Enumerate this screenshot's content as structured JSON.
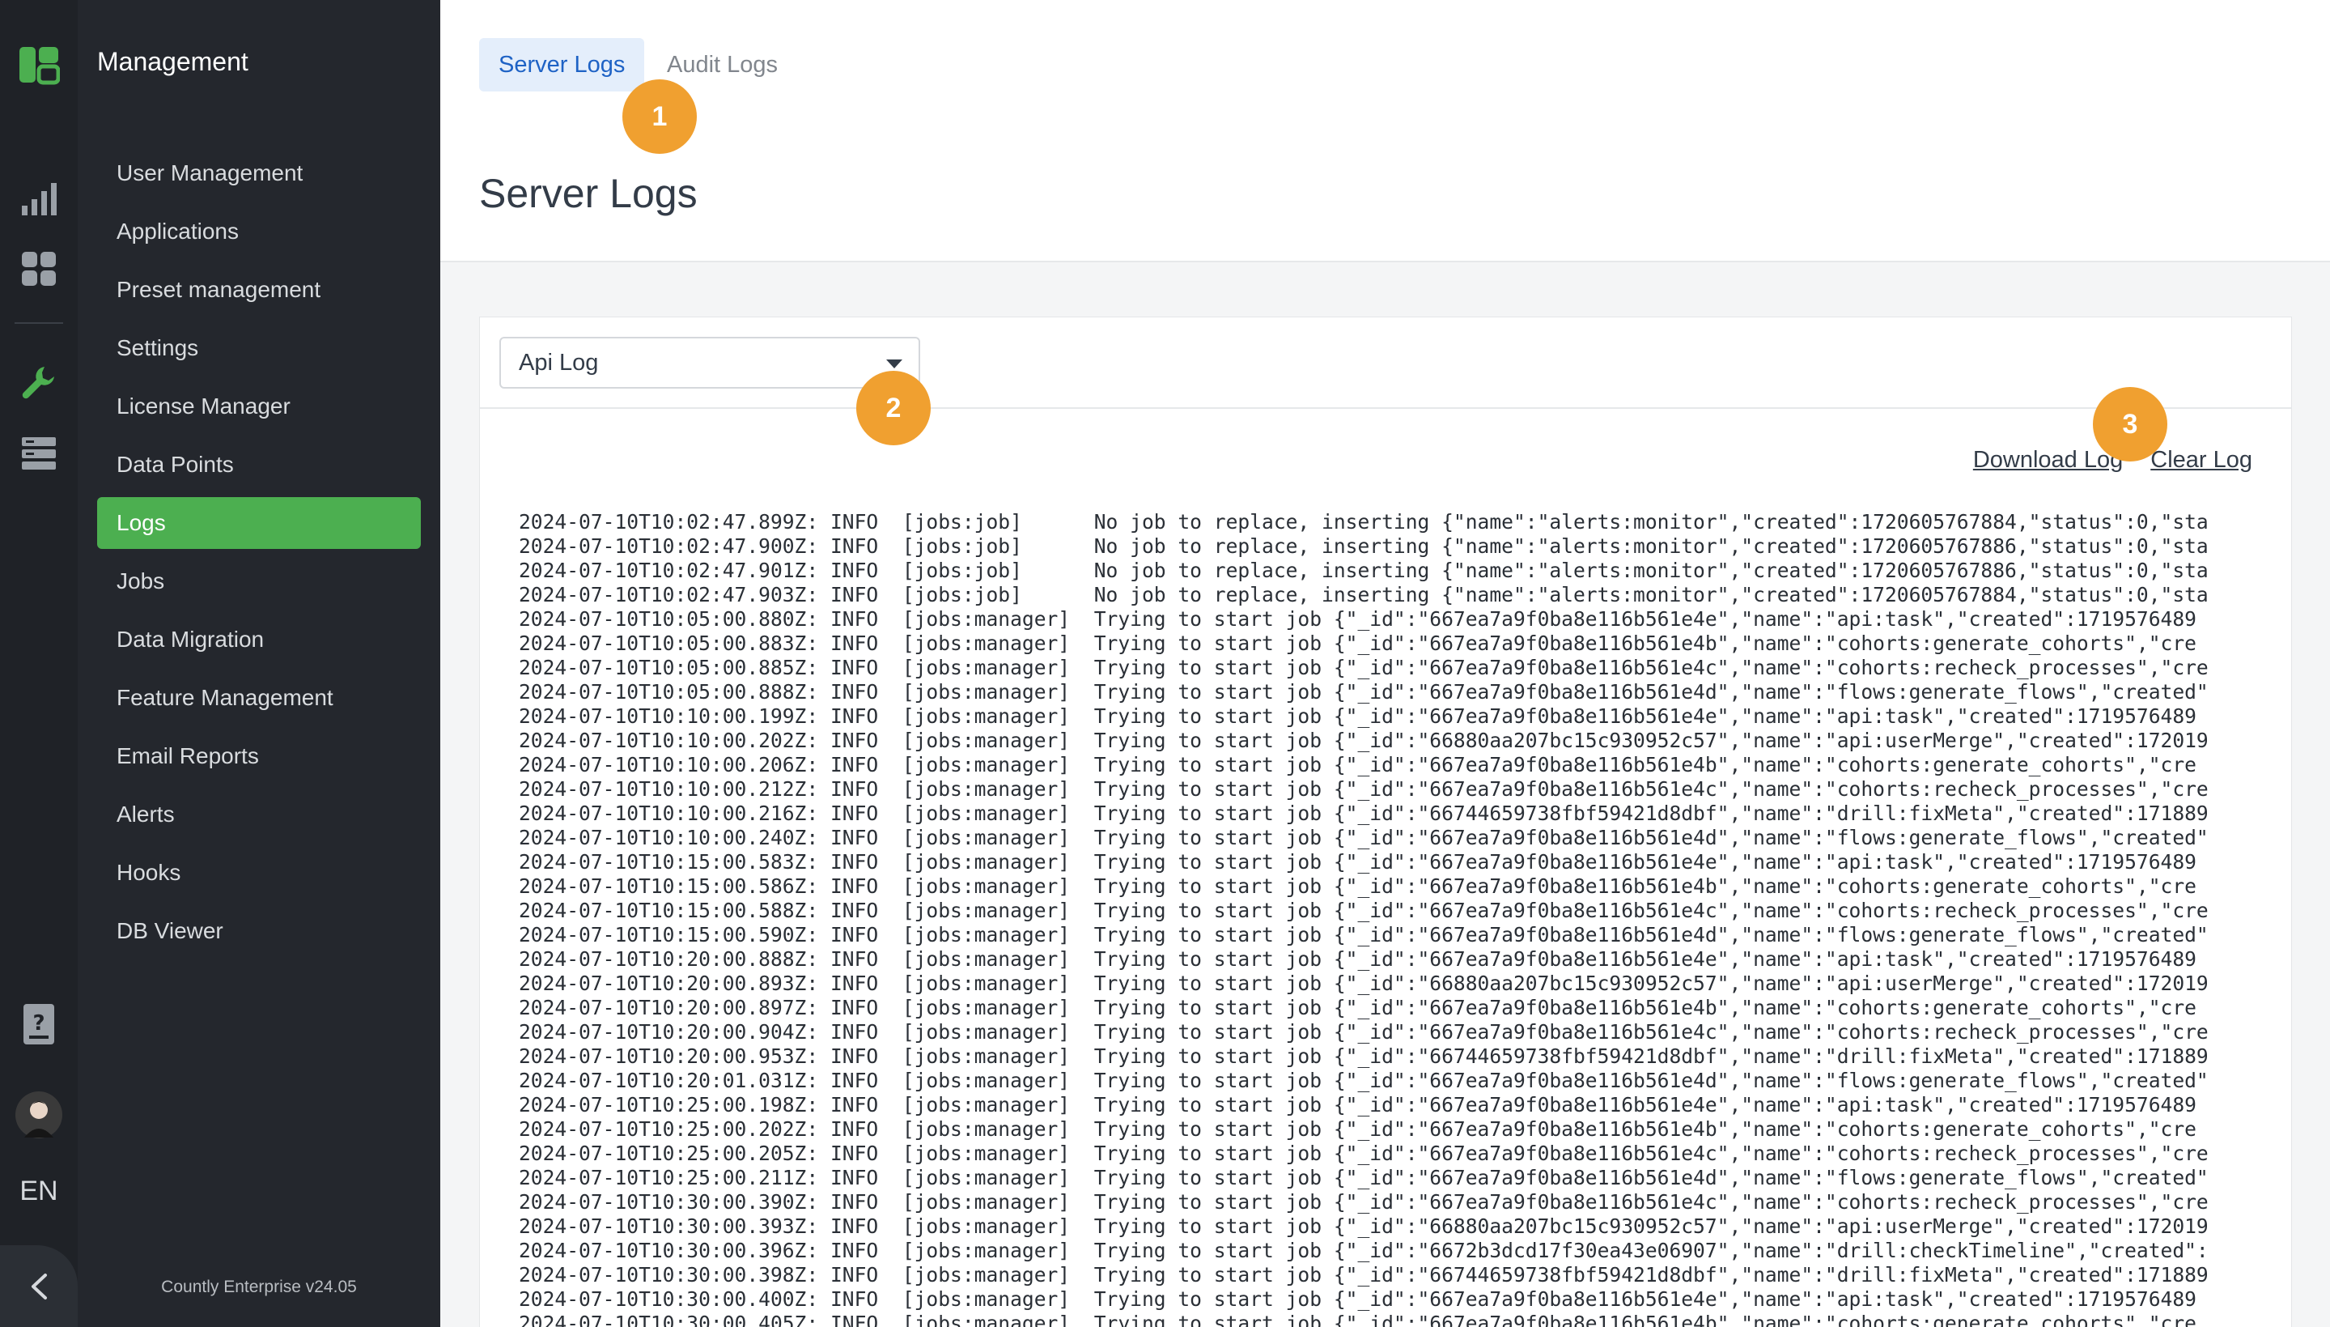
{
  "rail": {
    "icons": [
      "app-logo-icon",
      "dashboard-chart-icon",
      "apps-grid-icon",
      "wrench-icon",
      "server-stack-icon",
      "help-book-icon",
      "avatar",
      "chevron-left-icon"
    ],
    "language": "EN",
    "accent_color": "#4caf50"
  },
  "sidebar": {
    "title": "Management",
    "items": [
      {
        "label": "User Management"
      },
      {
        "label": "Applications"
      },
      {
        "label": "Preset management"
      },
      {
        "label": "Settings"
      },
      {
        "label": "License Manager"
      },
      {
        "label": "Data Points"
      },
      {
        "label": "Logs",
        "active": true
      },
      {
        "label": "Jobs"
      },
      {
        "label": "Data Migration"
      },
      {
        "label": "Feature Management"
      },
      {
        "label": "Email Reports"
      },
      {
        "label": "Alerts"
      },
      {
        "label": "Hooks"
      },
      {
        "label": "DB Viewer"
      }
    ],
    "version": "Countly Enterprise v24.05"
  },
  "header": {
    "tabs": [
      {
        "label": "Server Logs",
        "active": true
      },
      {
        "label": "Audit Logs"
      }
    ],
    "title": "Server Logs"
  },
  "badges": [
    "1",
    "2",
    "3"
  ],
  "panel": {
    "select_value": "Api Log",
    "download_label": "Download Log",
    "clear_label": "Clear Log"
  },
  "log_lines": [
    "2024-07-10T10:02:47.899Z: INFO  [jobs:job]      No job to replace, inserting {\"name\":\"alerts:monitor\",\"created\":1720605767884,\"status\":0,\"sta",
    "2024-07-10T10:02:47.900Z: INFO  [jobs:job]      No job to replace, inserting {\"name\":\"alerts:monitor\",\"created\":1720605767886,\"status\":0,\"sta",
    "2024-07-10T10:02:47.901Z: INFO  [jobs:job]      No job to replace, inserting {\"name\":\"alerts:monitor\",\"created\":1720605767886,\"status\":0,\"sta",
    "2024-07-10T10:02:47.903Z: INFO  [jobs:job]      No job to replace, inserting {\"name\":\"alerts:monitor\",\"created\":1720605767884,\"status\":0,\"sta",
    "2024-07-10T10:05:00.880Z: INFO  [jobs:manager]  Trying to start job {\"_id\":\"667ea7a9f0ba8e116b561e4e\",\"name\":\"api:task\",\"created\":1719576489",
    "2024-07-10T10:05:00.883Z: INFO  [jobs:manager]  Trying to start job {\"_id\":\"667ea7a9f0ba8e116b561e4b\",\"name\":\"cohorts:generate_cohorts\",\"cre",
    "2024-07-10T10:05:00.885Z: INFO  [jobs:manager]  Trying to start job {\"_id\":\"667ea7a9f0ba8e116b561e4c\",\"name\":\"cohorts:recheck_processes\",\"cre",
    "2024-07-10T10:05:00.888Z: INFO  [jobs:manager]  Trying to start job {\"_id\":\"667ea7a9f0ba8e116b561e4d\",\"name\":\"flows:generate_flows\",\"created\"",
    "2024-07-10T10:10:00.199Z: INFO  [jobs:manager]  Trying to start job {\"_id\":\"667ea7a9f0ba8e116b561e4e\",\"name\":\"api:task\",\"created\":1719576489",
    "2024-07-10T10:10:00.202Z: INFO  [jobs:manager]  Trying to start job {\"_id\":\"66880aa207bc15c930952c57\",\"name\":\"api:userMerge\",\"created\":172019",
    "2024-07-10T10:10:00.206Z: INFO  [jobs:manager]  Trying to start job {\"_id\":\"667ea7a9f0ba8e116b561e4b\",\"name\":\"cohorts:generate_cohorts\",\"cre",
    "2024-07-10T10:10:00.212Z: INFO  [jobs:manager]  Trying to start job {\"_id\":\"667ea7a9f0ba8e116b561e4c\",\"name\":\"cohorts:recheck_processes\",\"cre",
    "2024-07-10T10:10:00.216Z: INFO  [jobs:manager]  Trying to start job {\"_id\":\"66744659738fbf59421d8dbf\",\"name\":\"drill:fixMeta\",\"created\":171889",
    "2024-07-10T10:10:00.240Z: INFO  [jobs:manager]  Trying to start job {\"_id\":\"667ea7a9f0ba8e116b561e4d\",\"name\":\"flows:generate_flows\",\"created\"",
    "2024-07-10T10:15:00.583Z: INFO  [jobs:manager]  Trying to start job {\"_id\":\"667ea7a9f0ba8e116b561e4e\",\"name\":\"api:task\",\"created\":1719576489",
    "2024-07-10T10:15:00.586Z: INFO  [jobs:manager]  Trying to start job {\"_id\":\"667ea7a9f0ba8e116b561e4b\",\"name\":\"cohorts:generate_cohorts\",\"cre",
    "2024-07-10T10:15:00.588Z: INFO  [jobs:manager]  Trying to start job {\"_id\":\"667ea7a9f0ba8e116b561e4c\",\"name\":\"cohorts:recheck_processes\",\"cre",
    "2024-07-10T10:15:00.590Z: INFO  [jobs:manager]  Trying to start job {\"_id\":\"667ea7a9f0ba8e116b561e4d\",\"name\":\"flows:generate_flows\",\"created\"",
    "2024-07-10T10:20:00.888Z: INFO  [jobs:manager]  Trying to start job {\"_id\":\"667ea7a9f0ba8e116b561e4e\",\"name\":\"api:task\",\"created\":1719576489",
    "2024-07-10T10:20:00.893Z: INFO  [jobs:manager]  Trying to start job {\"_id\":\"66880aa207bc15c930952c57\",\"name\":\"api:userMerge\",\"created\":172019",
    "2024-07-10T10:20:00.897Z: INFO  [jobs:manager]  Trying to start job {\"_id\":\"667ea7a9f0ba8e116b561e4b\",\"name\":\"cohorts:generate_cohorts\",\"cre",
    "2024-07-10T10:20:00.904Z: INFO  [jobs:manager]  Trying to start job {\"_id\":\"667ea7a9f0ba8e116b561e4c\",\"name\":\"cohorts:recheck_processes\",\"cre",
    "2024-07-10T10:20:00.953Z: INFO  [jobs:manager]  Trying to start job {\"_id\":\"66744659738fbf59421d8dbf\",\"name\":\"drill:fixMeta\",\"created\":171889",
    "2024-07-10T10:20:01.031Z: INFO  [jobs:manager]  Trying to start job {\"_id\":\"667ea7a9f0ba8e116b561e4d\",\"name\":\"flows:generate_flows\",\"created\"",
    "2024-07-10T10:25:00.198Z: INFO  [jobs:manager]  Trying to start job {\"_id\":\"667ea7a9f0ba8e116b561e4e\",\"name\":\"api:task\",\"created\":1719576489",
    "2024-07-10T10:25:00.202Z: INFO  [jobs:manager]  Trying to start job {\"_id\":\"667ea7a9f0ba8e116b561e4b\",\"name\":\"cohorts:generate_cohorts\",\"cre",
    "2024-07-10T10:25:00.205Z: INFO  [jobs:manager]  Trying to start job {\"_id\":\"667ea7a9f0ba8e116b561e4c\",\"name\":\"cohorts:recheck_processes\",\"cre",
    "2024-07-10T10:25:00.211Z: INFO  [jobs:manager]  Trying to start job {\"_id\":\"667ea7a9f0ba8e116b561e4d\",\"name\":\"flows:generate_flows\",\"created\"",
    "2024-07-10T10:30:00.390Z: INFO  [jobs:manager]  Trying to start job {\"_id\":\"667ea7a9f0ba8e116b561e4c\",\"name\":\"cohorts:recheck_processes\",\"cre",
    "2024-07-10T10:30:00.393Z: INFO  [jobs:manager]  Trying to start job {\"_id\":\"66880aa207bc15c930952c57\",\"name\":\"api:userMerge\",\"created\":172019",
    "2024-07-10T10:30:00.396Z: INFO  [jobs:manager]  Trying to start job {\"_id\":\"6672b3dcd17f30ea43e06907\",\"name\":\"drill:checkTimeline\",\"created\":",
    "2024-07-10T10:30:00.398Z: INFO  [jobs:manager]  Trying to start job {\"_id\":\"66744659738fbf59421d8dbf\",\"name\":\"drill:fixMeta\",\"created\":171889",
    "2024-07-10T10:30:00.400Z: INFO  [jobs:manager]  Trying to start job {\"_id\":\"667ea7a9f0ba8e116b561e4e\",\"name\":\"api:task\",\"created\":1719576489",
    "2024-07-10T10:30:00.405Z: INFO  [jobs:manager]  Trying to start job {\"_id\":\"667ea7a9f0ba8e116b561e4b\",\"name\":\"cohorts:generate_cohorts\",\"cre"
  ]
}
